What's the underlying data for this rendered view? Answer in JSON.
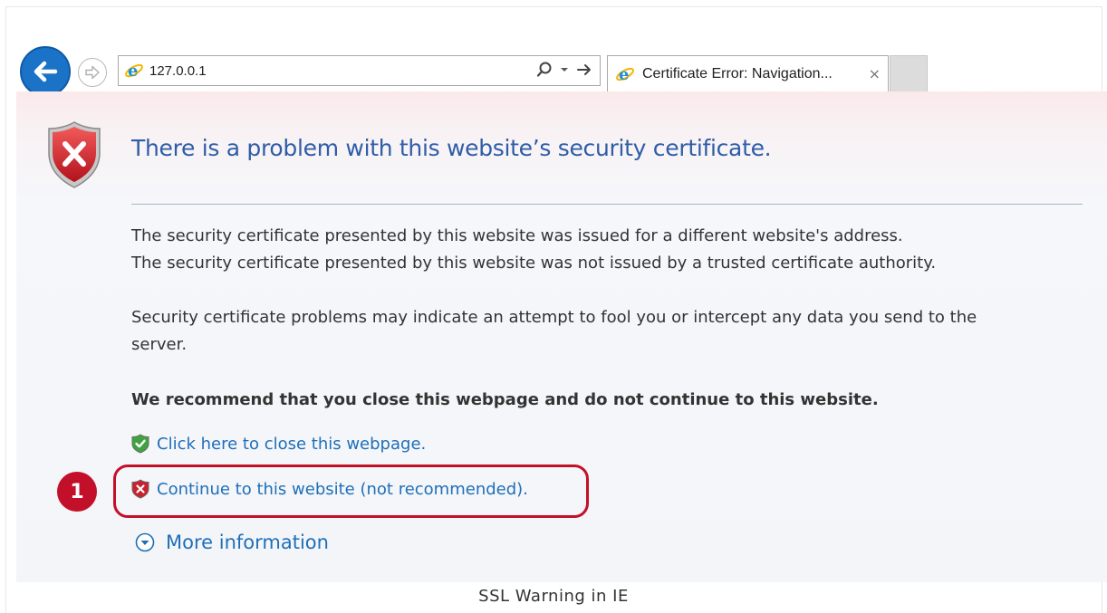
{
  "browser": {
    "address": "127.0.0.1",
    "tab_title": "Certificate Error: Navigation...",
    "tab_close": "×"
  },
  "page": {
    "title": "There is a problem with this website’s security certificate.",
    "line1": "The security certificate presented by this website was issued for a different website's address.",
    "line2": "The security certificate presented by this website was not issued by a trusted certificate authority.",
    "line3": "Security certificate problems may indicate an attempt to fool you or intercept any data you send to the",
    "line4": "server.",
    "recommend": "We recommend that you close this webpage and do not continue to this website.",
    "close_link": "Click here to close this webpage.",
    "continue_link": "Continue to this website (not recommended).",
    "more_info": "More information"
  },
  "annotation": {
    "badge": "1",
    "highlight_color": "#c3102a"
  },
  "caption": "SSL Warning in IE",
  "icons": [
    "back-arrow-icon",
    "forward-arrow-icon",
    "ie-logo-icon",
    "search-icon",
    "dropdown-icon",
    "go-arrow-icon",
    "shield-error-icon",
    "shield-ok-icon",
    "chevron-down-circle-icon"
  ]
}
